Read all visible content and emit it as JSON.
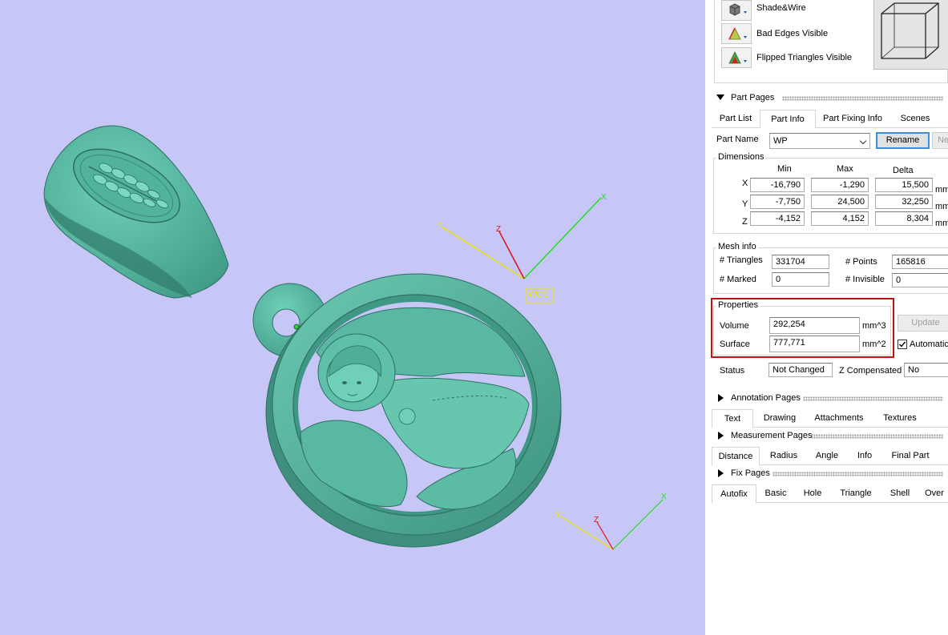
{
  "view_modes": [
    {
      "label": "Shade&Wire",
      "icon": "shade-wire-icon"
    },
    {
      "label": "Bad Edges Visible",
      "icon": "bad-edges-icon"
    },
    {
      "label": "Flipped Triangles Visible",
      "icon": "flipped-triangles-icon"
    }
  ],
  "viewport": {
    "wcs_label": "WCS",
    "axis_x": "X",
    "axis_y": "Y",
    "axis_z": "Z",
    "background": "#c7c7f7",
    "model_color": "#58b8a2"
  },
  "part_pages": {
    "title": "Part Pages",
    "tabs": [
      "Part List",
      "Part Info",
      "Part Fixing Info",
      "Scenes"
    ],
    "active_tab": "Part Info",
    "part_name_label": "Part Name",
    "part_name_value": "WP",
    "rename_label": "Rename",
    "next_label": "Ne",
    "dimensions": {
      "title": "Dimensions",
      "headers": [
        "Min",
        "Max",
        "Delta"
      ],
      "unit": "mm",
      "rows": [
        {
          "axis": "X",
          "min": "-16,790",
          "max": "-1,290",
          "delta": "15,500"
        },
        {
          "axis": "Y",
          "min": "-7,750",
          "max": "24,500",
          "delta": "32,250"
        },
        {
          "axis": "Z",
          "min": "-4,152",
          "max": "4,152",
          "delta": "8,304"
        }
      ]
    },
    "mesh_info": {
      "title": "Mesh info",
      "triangles_label": "# Triangles",
      "triangles_value": "331704",
      "points_label": "# Points",
      "points_value": "165816",
      "marked_label": "# Marked",
      "marked_value": "0",
      "invisible_label": "# Invisible",
      "invisible_value": "0"
    },
    "properties": {
      "title": "Properties",
      "volume_label": "Volume",
      "volume_value": "292,254",
      "volume_unit": "mm^3",
      "surface_label": "Surface",
      "surface_value": "777,771",
      "surface_unit": "mm^2",
      "update_label": "Update",
      "automatic_label": "Automatic",
      "automatic_checked": true
    },
    "status_label": "Status",
    "status_value": "Not Changed",
    "zcomp_label": "Z Compensated",
    "zcomp_value": "No"
  },
  "annotation_pages": {
    "title": "Annotation Pages",
    "tabs": [
      "Text",
      "Drawing",
      "Attachments",
      "Textures"
    ],
    "active_tab": "Text"
  },
  "measurement_pages": {
    "title": "Measurement Pages",
    "tabs": [
      "Distance",
      "Radius",
      "Angle",
      "Info",
      "Final Part"
    ],
    "active_tab": "Distance"
  },
  "fix_pages": {
    "title": "Fix Pages",
    "tabs": [
      "Autofix",
      "Basic",
      "Hole",
      "Triangle",
      "Shell",
      "Over"
    ],
    "active_tab": "Autofix"
  },
  "highlight_color": "#c41010"
}
